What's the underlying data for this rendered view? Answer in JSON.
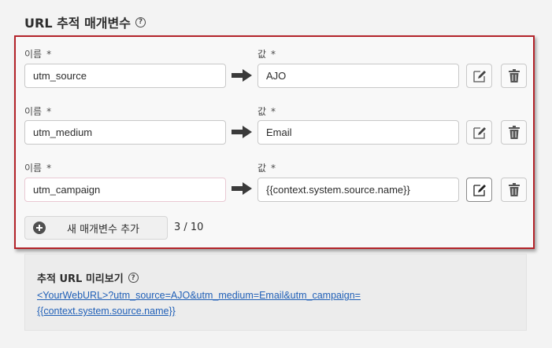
{
  "section": {
    "title": "URL 추적 매개변수",
    "help_icon": "question-circle-icon"
  },
  "labels": {
    "name": "이름",
    "value": "값",
    "required_marker": "*"
  },
  "params": [
    {
      "name": "utm_source",
      "value": "AJO"
    },
    {
      "name": "utm_medium",
      "value": "Email"
    },
    {
      "name": "utm_campaign",
      "value": "{{context.system.source.name}}"
    }
  ],
  "add_button": {
    "label": "새 매개변수 추가",
    "icon": "plus-circle-icon"
  },
  "counter": "3 / 10",
  "preview": {
    "title": "추적 URL 미리보기",
    "url_line1": "<YourWebURL>?utm_source=AJO&utm_medium=Email&utm_campaign=",
    "url_line2": "{{context.system.source.name}}"
  },
  "colors": {
    "highlight_border": "#b3232a",
    "link": "#1f5fb7"
  }
}
